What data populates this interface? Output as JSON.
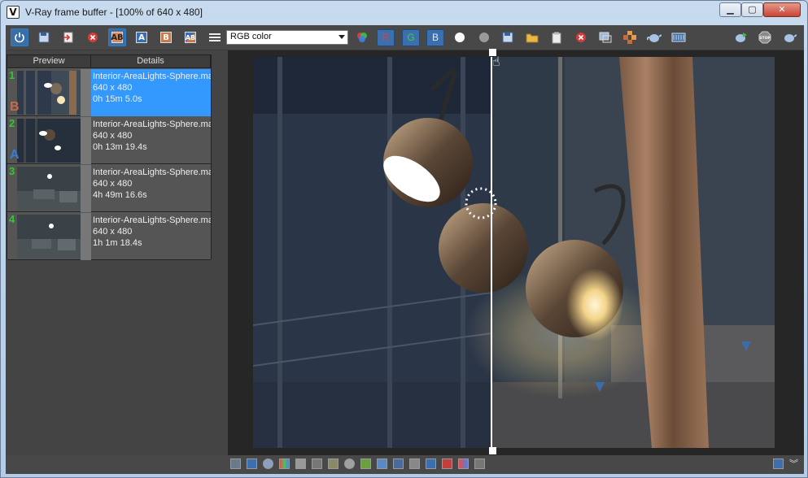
{
  "window": {
    "title": "V-Ray frame buffer - [100% of 640 x 480]",
    "app_icon": "vray-logo-icon",
    "controls": {
      "minimize": "▁",
      "maximize": "▢",
      "close": "✕"
    }
  },
  "toolbar": {
    "color_channel_select": "RGB color",
    "channels": {
      "r": "R",
      "g": "G",
      "b": "B"
    },
    "ab_buttons": {
      "a": "A",
      "b": "B"
    },
    "icons": [
      "power-icon",
      "save-icon",
      "load-icon",
      "clear-icon",
      "compare-ab-icon",
      "set-a-icon",
      "set-b-icon",
      "swap-ab-icon",
      "menu-icon",
      "color-channels-icon",
      "red-channel-icon",
      "green-channel-icon",
      "blue-channel-icon",
      "white-sphere-icon",
      "gray-sphere-icon",
      "save-image-icon",
      "open-folder-icon",
      "clipboard-icon",
      "stop-red-icon",
      "region-icon",
      "tiles-icon",
      "teapot-icon",
      "film-icon",
      "render-teapot-icon",
      "stop-icon",
      "teapot-settings-icon"
    ]
  },
  "history": {
    "headers": {
      "preview": "Preview",
      "details": "Details"
    },
    "markers": {
      "a": "A",
      "b": "B"
    },
    "items": [
      {
        "index": "1",
        "name": "Interior-AreaLights-Sphere.max",
        "resolution": "640 x 480",
        "time": "0h 15m 5.0s"
      },
      {
        "index": "2",
        "name": "Interior-AreaLights-Sphere.max",
        "resolution": "640 x 480",
        "time": "0h 13m 19.4s"
      },
      {
        "index": "3",
        "name": "Interior-AreaLights-Sphere.max",
        "resolution": "640 x 480",
        "time": "4h 49m 16.6s"
      },
      {
        "index": "4",
        "name": "Interior-AreaLights-Sphere.max",
        "resolution": "640 x 480",
        "time": "1h 1m 18.4s"
      }
    ]
  },
  "colors": {
    "accent": "#3399ff",
    "red_channel": "#e04040",
    "green_channel": "#40d040",
    "blue_channel": "#4a9aff"
  }
}
